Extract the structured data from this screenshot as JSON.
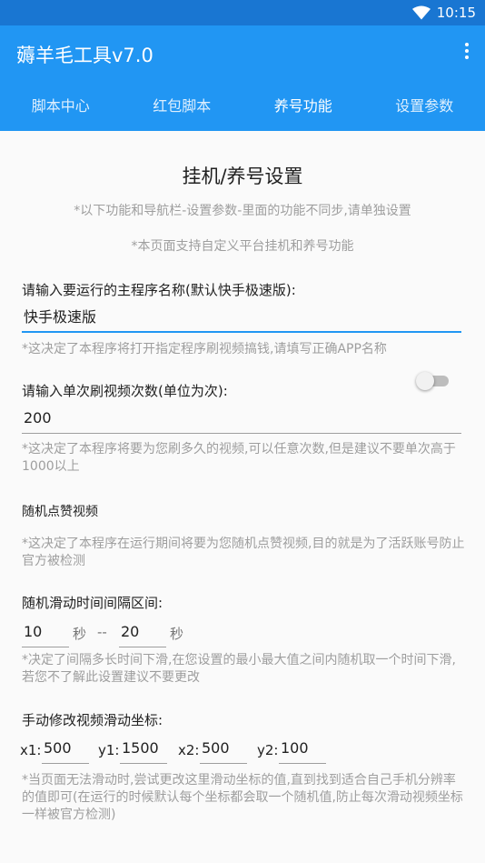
{
  "status": {
    "time": "10:15"
  },
  "app": {
    "title": "薅羊毛工具v7.0"
  },
  "tabs": [
    {
      "label": "脚本中心"
    },
    {
      "label": "红包脚本"
    },
    {
      "label": "养号功能"
    },
    {
      "label": "设置参数"
    }
  ],
  "page": {
    "title": "挂机/养号设置",
    "note1": "*以下功能和导航栏-设置参数-里面的功能不同步,请单独设置",
    "note2": "*本页面支持自定义平台挂机和养号功能"
  },
  "app_name": {
    "label": "请输入要运行的主程序名称(默认快手极速版):",
    "value": "快手极速版",
    "hint": "*这决定了本程序将打开指定程序刷视频搞钱,请填写正确APP名称"
  },
  "video_count": {
    "label": "请输入单次刷视频次数(单位为次):",
    "value": "200",
    "hint": "*这决定了本程序将要为您刷多久的视频,可以任意次数,但是建议不要单次高于1000以上"
  },
  "random_like": {
    "label": "随机点赞视频",
    "enabled": false,
    "hint": "*这决定了本程序在运行期间将要为您随机点赞视频,目的就是为了活跃账号防止官方被检测"
  },
  "swipe_interval": {
    "label": "随机滑动时间间隔区间:",
    "min": "10",
    "max": "20",
    "unit": "秒",
    "separator": "--",
    "hint": "*决定了间隔多长时间下滑,在您设置的最小最大值之间内随机取一个时间下滑,若您不了解此设置建议不要更改"
  },
  "swipe_coords": {
    "label": "手动修改视频滑动坐标:",
    "x1_label": "x1:",
    "x1": "500",
    "y1_label": "y1:",
    "y1": "1500",
    "x2_label": "x2:",
    "x2": "500",
    "y2_label": "y2:",
    "y2": "100",
    "hint": "*当页面无法滑动时,尝试更改这里滑动坐标的值,直到找到适合自己手机分辨率的值即可(在运行的时候默认每个坐标都会取一个随机值,防止每次滑动视频坐标一样被官方检测)"
  },
  "colors": {
    "primary": "#2196f3",
    "primary_dark": "#1976d2",
    "hint": "#9e9e9e"
  },
  "icons": [
    "wifi-icon",
    "more-vert-icon"
  ]
}
